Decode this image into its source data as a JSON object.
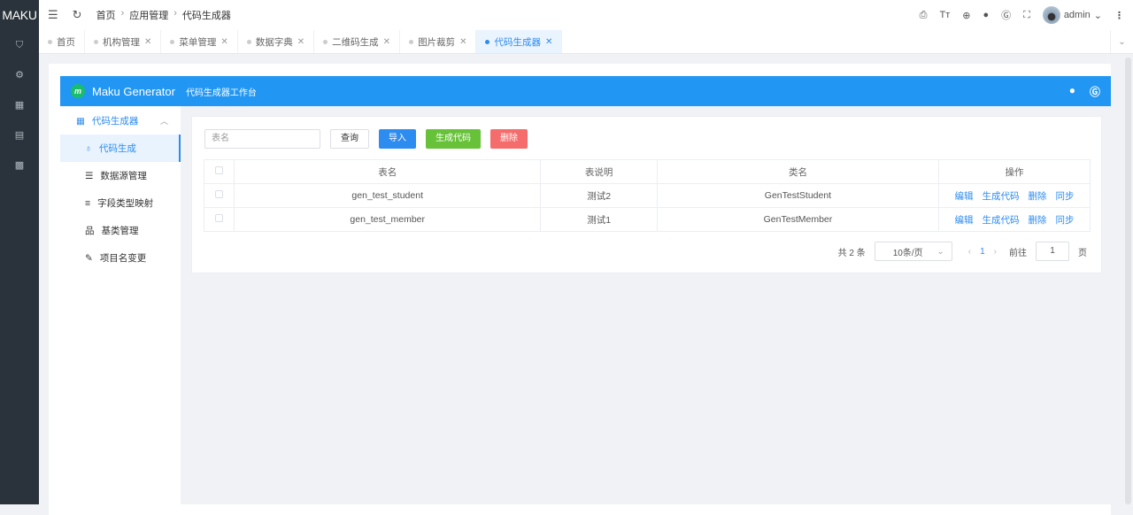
{
  "app": {
    "logo": "MAKU"
  },
  "sidebar_icons": [
    "shield-icon",
    "gear-icon",
    "grid-icon",
    "document-icon",
    "apps-icon"
  ],
  "header": {
    "breadcrumb": [
      "首页",
      "应用管理",
      "代码生成器"
    ],
    "user": "admin"
  },
  "tabs": [
    {
      "label": "首页",
      "closable": false
    },
    {
      "label": "机构管理",
      "closable": true
    },
    {
      "label": "菜单管理",
      "closable": true
    },
    {
      "label": "数据字典",
      "closable": true
    },
    {
      "label": "二维码生成",
      "closable": true
    },
    {
      "label": "图片裁剪",
      "closable": true
    },
    {
      "label": "代码生成器",
      "closable": true,
      "active": true
    }
  ],
  "banner": {
    "logo": "m",
    "title": "Maku Generator",
    "subtitle": "代码生成器工作台"
  },
  "menu": {
    "group": "代码生成器",
    "items": [
      "代码生成",
      "数据源管理",
      "字段类型映射",
      "基类管理",
      "项目名变更"
    ]
  },
  "toolbar": {
    "placeholder": "表名",
    "query": "查询",
    "import": "导入",
    "generate": "生成代码",
    "delete": "删除"
  },
  "table": {
    "headers": [
      "表名",
      "表说明",
      "类名",
      "操作"
    ],
    "rows": [
      {
        "name": "gen_test_student",
        "desc": "测试2",
        "cls": "GenTestStudent"
      },
      {
        "name": "gen_test_member",
        "desc": "测试1",
        "cls": "GenTestMember"
      }
    ],
    "actions": [
      "编辑",
      "生成代码",
      "删除",
      "同步"
    ]
  },
  "pager": {
    "total": "共 2 条",
    "size": "10条/页",
    "page": "1",
    "goto": "前往",
    "goto_value": "1",
    "suffix": "页"
  }
}
